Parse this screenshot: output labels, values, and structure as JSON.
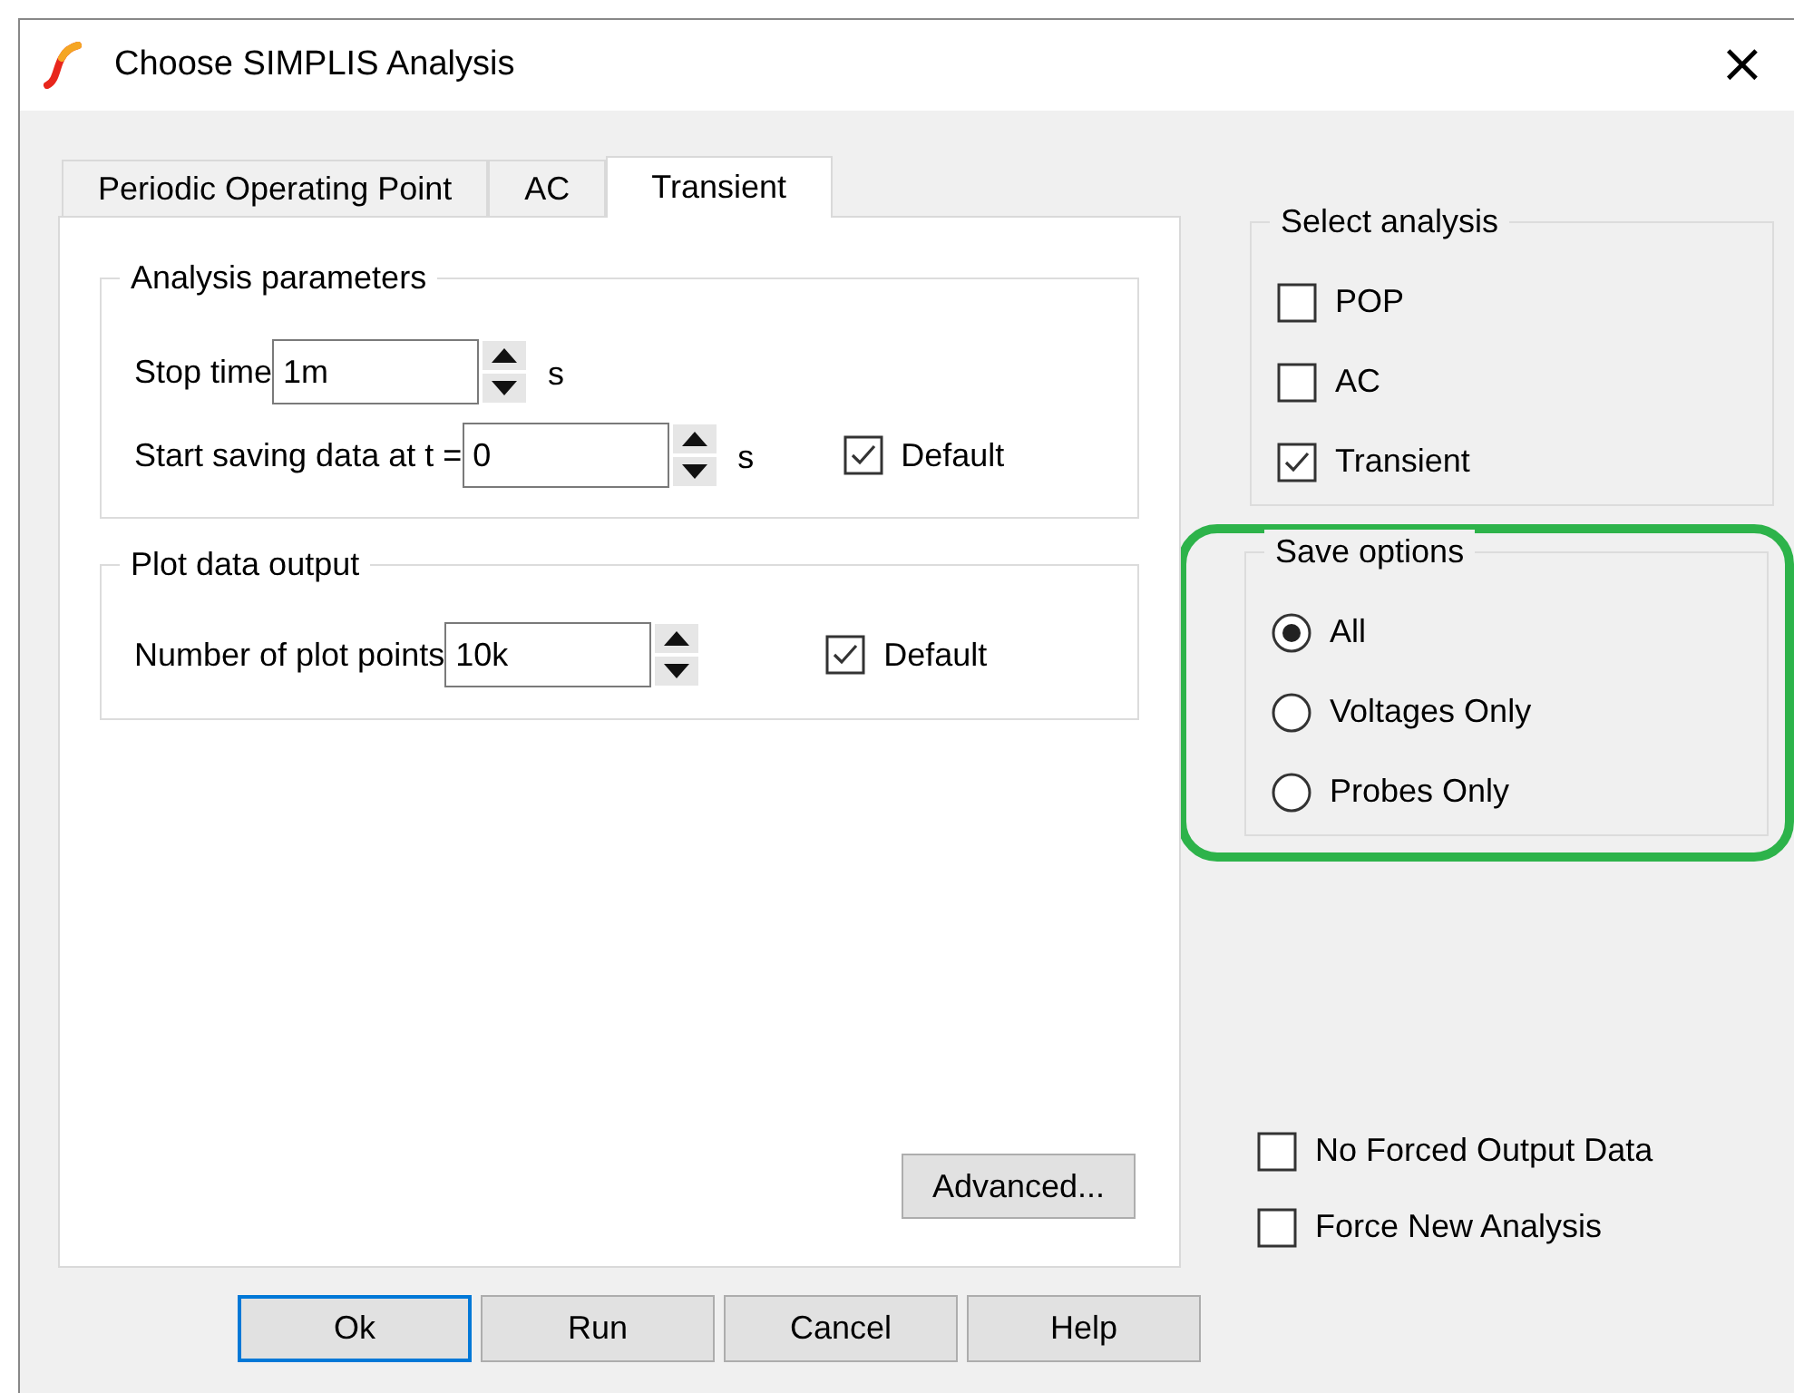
{
  "window": {
    "title": "Choose SIMPLIS Analysis",
    "close": "×"
  },
  "tabs": [
    {
      "label": "Periodic Operating Point",
      "selected": false
    },
    {
      "label": "AC",
      "selected": false
    },
    {
      "label": "Transient",
      "selected": true
    }
  ],
  "analysis_parameters": {
    "title": "Analysis parameters",
    "rows": [
      {
        "label": "Stop time",
        "value": "1m",
        "unit": "s"
      },
      {
        "label": "Start saving data at t =",
        "value": "0",
        "unit": "s",
        "default": {
          "label": "Default",
          "checked": true
        }
      }
    ]
  },
  "plot_data_output": {
    "title": "Plot data output",
    "rows": [
      {
        "label": "Number of plot points",
        "value": "10k",
        "default": {
          "label": "Default",
          "checked": true
        }
      }
    ]
  },
  "advanced_button": "Advanced...",
  "select_analysis": {
    "title": "Select analysis",
    "items": [
      {
        "label": "POP",
        "checked": false
      },
      {
        "label": "AC",
        "checked": false
      },
      {
        "label": "Transient",
        "checked": true
      }
    ]
  },
  "save_options": {
    "title": "Save options",
    "highlighted": true,
    "items": [
      {
        "label": "All",
        "selected": true
      },
      {
        "label": "Voltages Only",
        "selected": false
      },
      {
        "label": "Probes Only",
        "selected": false
      }
    ]
  },
  "options": [
    {
      "label": "No Forced Output Data",
      "checked": false
    },
    {
      "label": "Force New Analysis",
      "checked": false
    }
  ],
  "buttons": [
    {
      "label": "Ok",
      "default": true
    },
    {
      "label": "Run",
      "default": false
    },
    {
      "label": "Cancel",
      "default": false
    },
    {
      "label": "Help",
      "default": false
    }
  ]
}
